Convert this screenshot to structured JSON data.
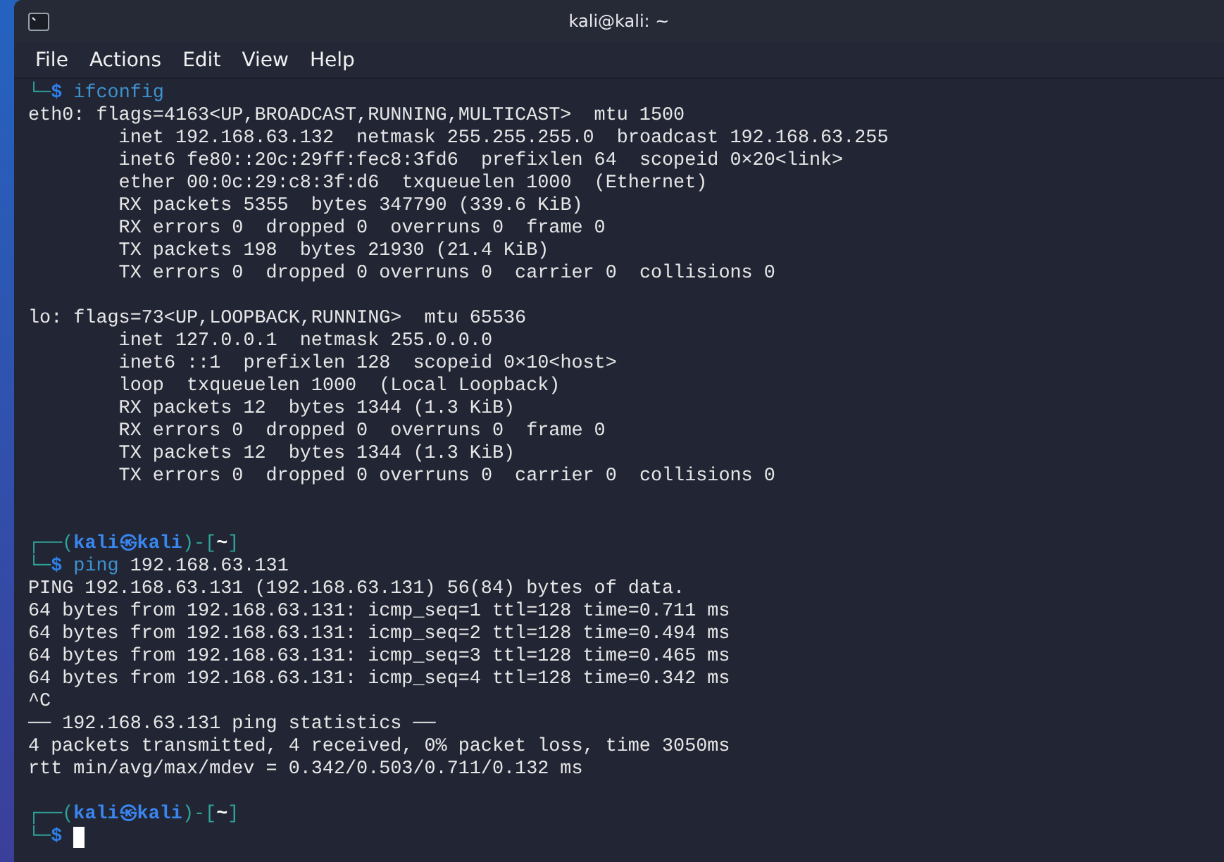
{
  "window": {
    "title": "kali@kali: ~"
  },
  "menu": [
    "File",
    "Actions",
    "Edit",
    "View",
    "Help"
  ],
  "lines": [
    {
      "kind": "command",
      "prompt": "└─$",
      "command": "ifconfig"
    },
    {
      "kind": "output",
      "text": "eth0: flags=4163<UP,BROADCAST,RUNNING,MULTICAST>  mtu 1500"
    },
    {
      "kind": "output",
      "text": "        inet 192.168.63.132  netmask 255.255.255.0  broadcast 192.168.63.255"
    },
    {
      "kind": "output",
      "text": "        inet6 fe80::20c:29ff:fec8:3fd6  prefixlen 64  scopeid 0×20<link>"
    },
    {
      "kind": "output",
      "text": "        ether 00:0c:29:c8:3f:d6  txqueuelen 1000  (Ethernet)"
    },
    {
      "kind": "output",
      "text": "        RX packets 5355  bytes 347790 (339.6 KiB)"
    },
    {
      "kind": "output",
      "text": "        RX errors 0  dropped 0  overruns 0  frame 0"
    },
    {
      "kind": "output",
      "text": "        TX packets 198  bytes 21930 (21.4 KiB)"
    },
    {
      "kind": "output",
      "text": "        TX errors 0  dropped 0 overruns 0  carrier 0  collisions 0"
    },
    {
      "kind": "blank"
    },
    {
      "kind": "output",
      "text": "lo: flags=73<UP,LOOPBACK,RUNNING>  mtu 65536"
    },
    {
      "kind": "output",
      "text": "        inet 127.0.0.1  netmask 255.0.0.0"
    },
    {
      "kind": "output",
      "text": "        inet6 ::1  prefixlen 128  scopeid 0×10<host>"
    },
    {
      "kind": "output",
      "text": "        loop  txqueuelen 1000  (Local Loopback)"
    },
    {
      "kind": "output",
      "text": "        RX packets 12  bytes 1344 (1.3 KiB)"
    },
    {
      "kind": "output",
      "text": "        RX errors 0  dropped 0  overruns 0  frame 0"
    },
    {
      "kind": "output",
      "text": "        TX packets 12  bytes 1344 (1.3 KiB)"
    },
    {
      "kind": "output",
      "text": "        TX errors 0  dropped 0 overruns 0  carrier 0  collisions 0"
    },
    {
      "kind": "blank"
    },
    {
      "kind": "blank"
    },
    {
      "kind": "prompt_head",
      "open": "┌──(",
      "user": "kali",
      "at": "㉿",
      "host": "kali",
      "mid": ")-[",
      "dir": "~",
      "close": "]"
    },
    {
      "kind": "command",
      "prompt": "└─$",
      "command": "ping",
      "args": "192.168.63.131"
    },
    {
      "kind": "output",
      "text": "PING 192.168.63.131 (192.168.63.131) 56(84) bytes of data."
    },
    {
      "kind": "output",
      "text": "64 bytes from 192.168.63.131: icmp_seq=1 ttl=128 time=0.711 ms"
    },
    {
      "kind": "output",
      "text": "64 bytes from 192.168.63.131: icmp_seq=2 ttl=128 time=0.494 ms"
    },
    {
      "kind": "output",
      "text": "64 bytes from 192.168.63.131: icmp_seq=3 ttl=128 time=0.465 ms"
    },
    {
      "kind": "output",
      "text": "64 bytes from 192.168.63.131: icmp_seq=4 ttl=128 time=0.342 ms"
    },
    {
      "kind": "output",
      "text": "^C"
    },
    {
      "kind": "output",
      "text": "── 192.168.63.131 ping statistics ──"
    },
    {
      "kind": "output",
      "text": "4 packets transmitted, 4 received, 0% packet loss, time 3050ms"
    },
    {
      "kind": "output",
      "text": "rtt min/avg/max/mdev = 0.342/0.503/0.711/0.132 ms"
    },
    {
      "kind": "blank"
    },
    {
      "kind": "prompt_head",
      "open": "┌──(",
      "user": "kali",
      "at": "㉿",
      "host": "kali",
      "mid": ")-[",
      "dir": "~",
      "close": "]"
    },
    {
      "kind": "input",
      "prompt": "└─$"
    }
  ]
}
